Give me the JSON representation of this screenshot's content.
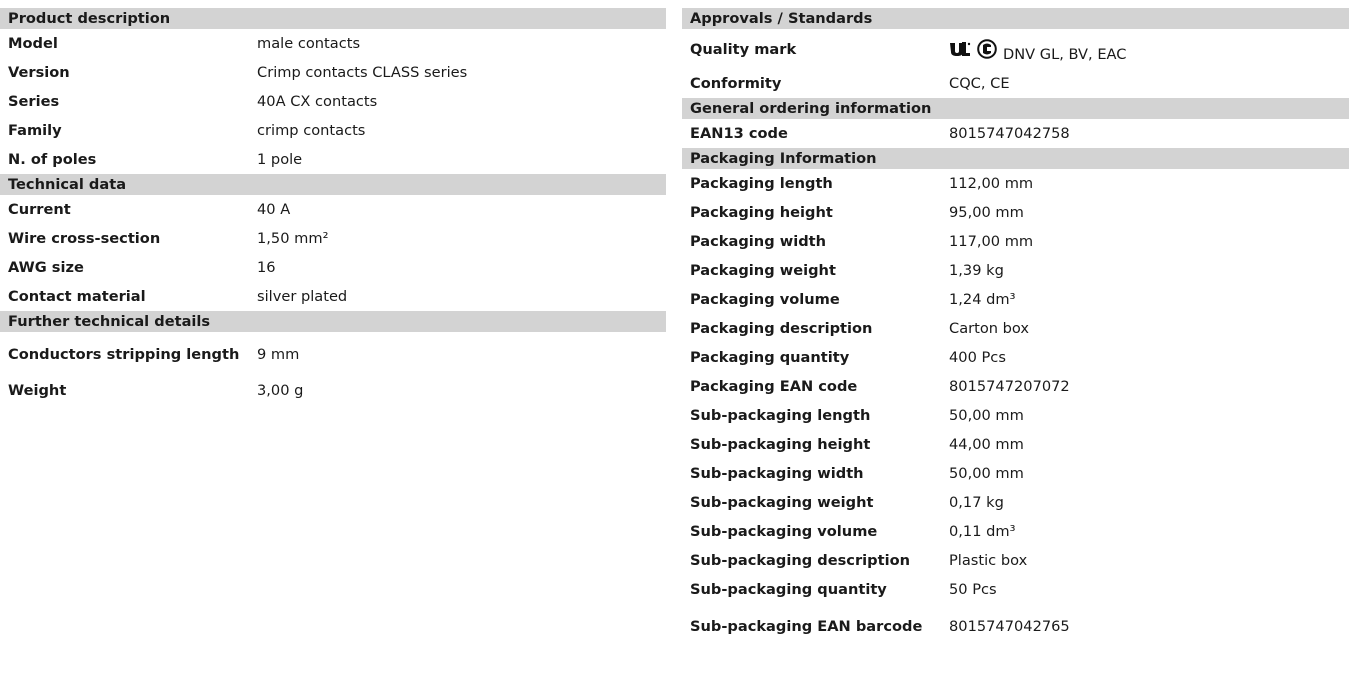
{
  "left_column": {
    "sections": [
      {
        "title": "Product description",
        "rows": [
          {
            "label": "Model",
            "value": "male contacts"
          },
          {
            "label": "Version",
            "value": "Crimp contacts CLASS series"
          },
          {
            "label": "Series",
            "value": "40A CX contacts"
          },
          {
            "label": "Family",
            "value": "crimp contacts"
          },
          {
            "label": "N. of poles",
            "value": "1 pole"
          }
        ]
      },
      {
        "title": "Technical data",
        "rows": [
          {
            "label": "Current",
            "value": "40 A"
          },
          {
            "label": "Wire cross-section",
            "value": "1,50 mm²"
          },
          {
            "label": "AWG size",
            "value": "16"
          },
          {
            "label": "Contact material",
            "value": "silver plated"
          }
        ]
      },
      {
        "title": "Further technical details",
        "rows": [
          {
            "label": "Conductors stripping length",
            "value": "9 mm"
          },
          {
            "label": "Weight",
            "value": "3,00 g"
          }
        ]
      }
    ]
  },
  "right_column": {
    "approvals": {
      "title": "Approvals / Standards",
      "quality_mark": {
        "label": "Quality mark",
        "icons": [
          "ul-recognized-icon",
          "csa-icon"
        ],
        "value": "DNV GL, BV, EAC"
      },
      "conformity": {
        "label": "Conformity",
        "value": "CQC, CE"
      }
    },
    "sections": [
      {
        "title": "General ordering information",
        "rows": [
          {
            "label": "EAN13 code",
            "value": "8015747042758"
          }
        ]
      },
      {
        "title": "Packaging Information",
        "rows": [
          {
            "label": "Packaging length",
            "value": "112,00 mm"
          },
          {
            "label": "Packaging height",
            "value": "95,00 mm"
          },
          {
            "label": "Packaging width",
            "value": "117,00 mm"
          },
          {
            "label": "Packaging weight",
            "value": "1,39 kg"
          },
          {
            "label": "Packaging volume",
            "value": "1,24 dm³"
          },
          {
            "label": "Packaging description",
            "value": "Carton box"
          },
          {
            "label": "Packaging quantity",
            "value": "400 Pcs"
          },
          {
            "label": "Packaging EAN code",
            "value": "8015747207072"
          },
          {
            "label": "Sub-packaging length",
            "value": "50,00 mm"
          },
          {
            "label": "Sub-packaging height",
            "value": "44,00 mm"
          },
          {
            "label": "Sub-packaging width",
            "value": "50,00 mm"
          },
          {
            "label": "Sub-packaging weight",
            "value": "0,17 kg"
          },
          {
            "label": "Sub-packaging volume",
            "value": "0,11 dm³"
          },
          {
            "label": "Sub-packaging description",
            "value": "Plastic box"
          },
          {
            "label": "Sub-packaging quantity",
            "value": "50 Pcs"
          },
          {
            "label": "Sub-packaging EAN barcode",
            "value": "8015747042765"
          }
        ]
      }
    ]
  }
}
